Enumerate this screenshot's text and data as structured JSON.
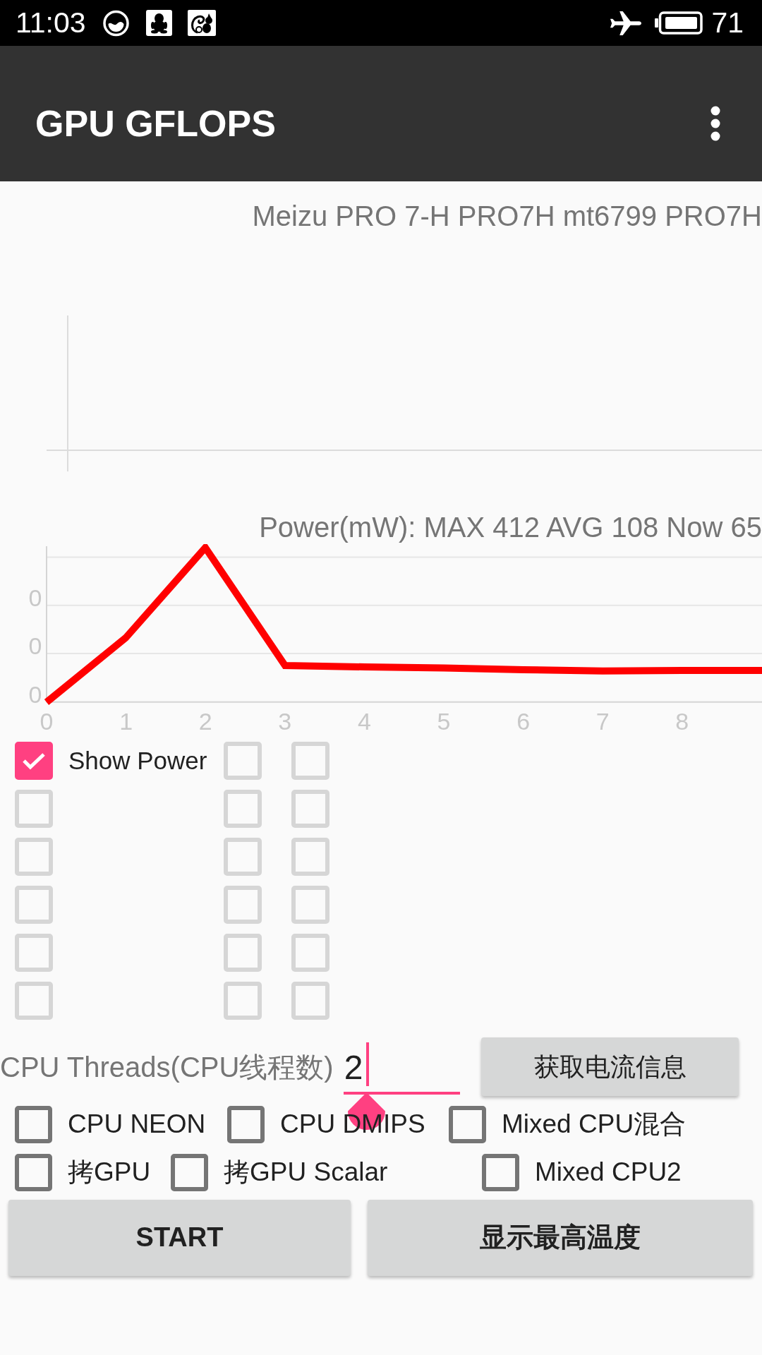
{
  "status_bar": {
    "time": "11:03",
    "battery": "71"
  },
  "app_bar": {
    "title": "GPU GFLOPS"
  },
  "device_info": "Meizu PRO 7-H PRO7H mt6799 PRO7H",
  "power_chart": {
    "title": "Power(mW): MAX 412 AVG 108 Now 65",
    "y_tick_labels": [
      "0",
      "0",
      "0"
    ],
    "x_tick_labels": [
      "0",
      "1",
      "2",
      "3",
      "4",
      "5",
      "6",
      "7",
      "8"
    ]
  },
  "checkbox_grid": {
    "rows": [
      {
        "boxes": [
          {
            "label": "Show Power",
            "checked": true,
            "disabled": false
          },
          {
            "checked": false,
            "disabled": true
          },
          {
            "checked": false,
            "disabled": true
          }
        ]
      },
      {
        "boxes": [
          {
            "checked": false,
            "disabled": true
          },
          {
            "checked": false,
            "disabled": true
          },
          {
            "checked": false,
            "disabled": true
          }
        ]
      },
      {
        "boxes": [
          {
            "checked": false,
            "disabled": true
          },
          {
            "checked": false,
            "disabled": true
          },
          {
            "checked": false,
            "disabled": true
          }
        ]
      },
      {
        "boxes": [
          {
            "checked": false,
            "disabled": true
          },
          {
            "checked": false,
            "disabled": true
          },
          {
            "checked": false,
            "disabled": true
          }
        ]
      },
      {
        "boxes": [
          {
            "checked": false,
            "disabled": true
          },
          {
            "checked": false,
            "disabled": true
          },
          {
            "checked": false,
            "disabled": true
          }
        ]
      },
      {
        "boxes": [
          {
            "checked": false,
            "disabled": true
          },
          {
            "checked": false,
            "disabled": true
          },
          {
            "checked": false,
            "disabled": true
          }
        ]
      }
    ]
  },
  "threads": {
    "label": "CPU Threads(CPU线程数)",
    "value": "2",
    "focused": true
  },
  "current_info_button": "获取电流信息",
  "options": {
    "rows": [
      {
        "items": [
          {
            "label": "CPU NEON",
            "checked": false
          },
          {
            "label": "CPU DMIPS",
            "checked": false
          },
          {
            "label": "Mixed CPU混合",
            "checked": false
          }
        ]
      },
      {
        "items": [
          {
            "label": "拷GPU",
            "checked": false
          },
          {
            "label": "拷GPU Scalar",
            "checked": false
          },
          {
            "label": "Mixed CPU2",
            "checked": false
          }
        ]
      }
    ]
  },
  "actions": [
    "START",
    "显示最高温度"
  ]
}
